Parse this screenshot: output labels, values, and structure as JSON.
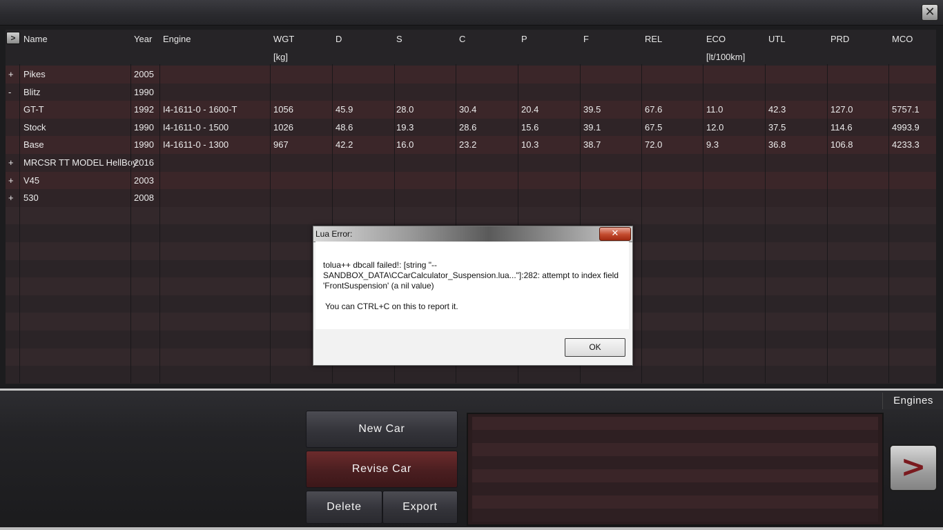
{
  "window": {
    "close_glyph": "✕"
  },
  "table": {
    "expand_glyph": ">",
    "columns": [
      {
        "label": "Name",
        "unit": ""
      },
      {
        "label": "Year",
        "unit": ""
      },
      {
        "label": "Engine",
        "unit": ""
      },
      {
        "label": "WGT",
        "unit": "[kg]"
      },
      {
        "label": "D",
        "unit": ""
      },
      {
        "label": "S",
        "unit": ""
      },
      {
        "label": "C",
        "unit": ""
      },
      {
        "label": "P",
        "unit": ""
      },
      {
        "label": "F",
        "unit": ""
      },
      {
        "label": "REL",
        "unit": ""
      },
      {
        "label": "ECO",
        "unit": "[lt/100km]"
      },
      {
        "label": "UTL",
        "unit": ""
      },
      {
        "label": "PRD",
        "unit": ""
      },
      {
        "label": "MCO",
        "unit": ""
      }
    ],
    "rows": [
      {
        "toggle": "+",
        "cells": [
          "Pikes",
          "2005",
          "",
          "",
          "",
          "",
          "",
          "",
          "",
          "",
          "",
          "",
          "",
          ""
        ]
      },
      {
        "toggle": "-",
        "cells": [
          "Blitz",
          "1990",
          "",
          "",
          "",
          "",
          "",
          "",
          "",
          "",
          "",
          "",
          "",
          ""
        ]
      },
      {
        "toggle": "",
        "cells": [
          "GT-T",
          "1992",
          "I4-1611-0 - 1600-T",
          "1056",
          "45.9",
          "28.0",
          "30.4",
          "20.4",
          "39.5",
          "67.6",
          "11.0",
          "42.3",
          "127.0",
          "5757.1"
        ]
      },
      {
        "toggle": "",
        "cells": [
          "Stock",
          "1990",
          "I4-1611-0 - 1500",
          "1026",
          "48.6",
          "19.3",
          "28.6",
          "15.6",
          "39.1",
          "67.5",
          "12.0",
          "37.5",
          "114.6",
          "4993.9"
        ]
      },
      {
        "toggle": "",
        "cells": [
          "Base",
          "1990",
          "I4-1611-0 - 1300",
          "967",
          "42.2",
          "16.0",
          "23.2",
          "10.3",
          "38.7",
          "72.0",
          "9.3",
          "36.8",
          "106.8",
          "4233.3"
        ]
      },
      {
        "toggle": "+",
        "cells": [
          "MRCSR TT MODEL HellBoy",
          "2016",
          "",
          "",
          "",
          "",
          "",
          "",
          "",
          "",
          "",
          "",
          "",
          ""
        ]
      },
      {
        "toggle": "+",
        "cells": [
          "V45",
          "2003",
          "",
          "",
          "",
          "",
          "",
          "",
          "",
          "",
          "",
          "",
          "",
          ""
        ]
      },
      {
        "toggle": "+",
        "cells": [
          "530",
          "2008",
          "",
          "",
          "",
          "",
          "",
          "",
          "",
          "",
          "",
          "",
          "",
          ""
        ]
      }
    ]
  },
  "dialog": {
    "title": "Lua Error:",
    "close_glyph": "✕",
    "message": "tolua++ dbcall failed!: [string \"--SANDBOX_DATA\\CCarCalculator_Suspension.lua...\"]:282: attempt to index field 'FrontSuspension' (a nil value)",
    "hint": "You can CTRL+C on this to report it.",
    "ok_label": "OK"
  },
  "bottom": {
    "engines_label": "Engines",
    "new_car_label": "New Car",
    "revise_car_label": "Revise Car",
    "delete_label": "Delete",
    "export_label": "Export",
    "next_glyph": ">"
  },
  "colors": {
    "row_highlight": "#3b2629",
    "row_dark": "#2f2427",
    "accent_red": "#7a1a1f"
  }
}
